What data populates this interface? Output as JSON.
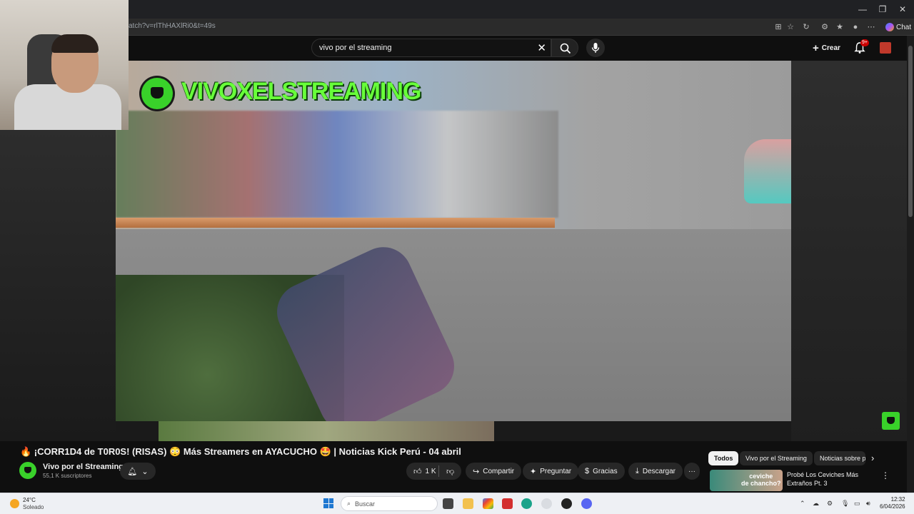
{
  "browser": {
    "url": "atch?v=rlThHAXlRi0&t=49s",
    "chat_label": "Chat",
    "window_controls": [
      "minimize",
      "restore",
      "close"
    ]
  },
  "header": {
    "search_value": "vivo por el streaming",
    "create_label": "Crear",
    "notifications_badge": "9+"
  },
  "video": {
    "banner_text": "VIVOXELSTREAMING",
    "title": "🔥 ¡CORR1D4 de T0R0S! (RISAS) 😳 Más Streamers en AYACUCHO 🤩 | Noticias Kick Perú - 04 abril"
  },
  "channel": {
    "name": "Vivo por el Streaming",
    "subscribers": "55,1 K suscriptores"
  },
  "actions": {
    "likes": "1 K",
    "share": "Compartir",
    "ask": "Preguntar",
    "thanks": "Gracias",
    "download": "Descargar",
    "more": "···"
  },
  "chips": [
    "Todos",
    "Vivo por el Streaming",
    "Noticias sobre p"
  ],
  "recommendation": {
    "thumb_text": "ceviche\nde chancho?",
    "title": "Probé Los Ceviches Más Extraños Pt. 3"
  },
  "taskbar": {
    "temperature": "24°C",
    "weather": "Soleado",
    "search_placeholder": "Buscar",
    "time": "12:32",
    "date": "6/04/2026"
  },
  "colors": {
    "accent_green": "#39d12a",
    "banner_green": "#68ff3a",
    "youtube_red": "#cc0000"
  }
}
